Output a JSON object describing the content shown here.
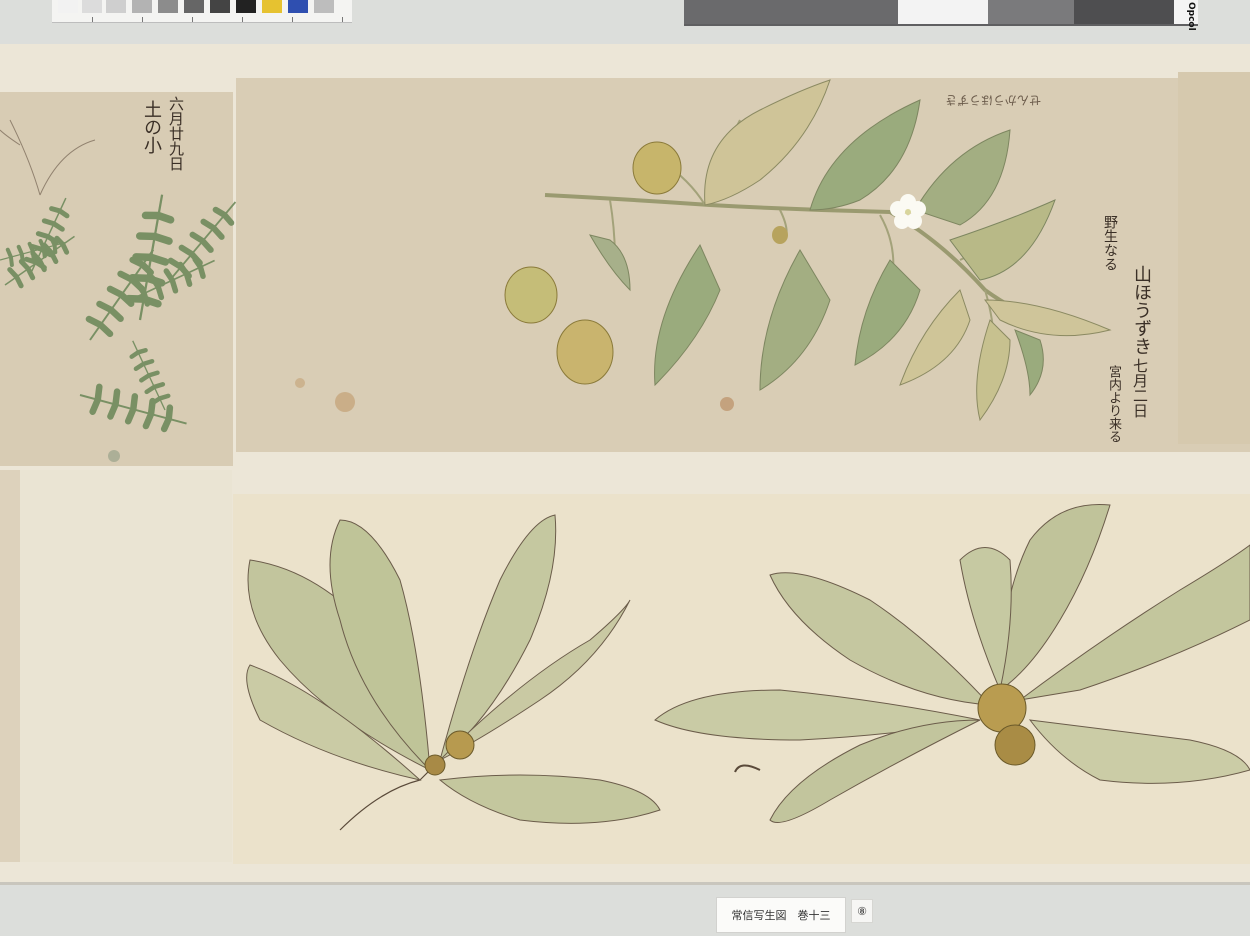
{
  "title": "常信写生図　巻十三",
  "plate_number": "⑧",
  "graycard_label": "Opcol",
  "inscriptions": {
    "left_date": "六月廿九日",
    "left_name": "土の小",
    "mid_name": "山ほうずき",
    "mid_note": "野生なる",
    "mid_date": "七月二日",
    "mid_source": "宮内より来る",
    "top_note": "せんかうほうずき"
  },
  "colors": {
    "paper": "#d9cdb5",
    "leaf_green": "#8fa27a",
    "oak_leaf": "#c3c79f",
    "ink": "#3a2f26"
  }
}
